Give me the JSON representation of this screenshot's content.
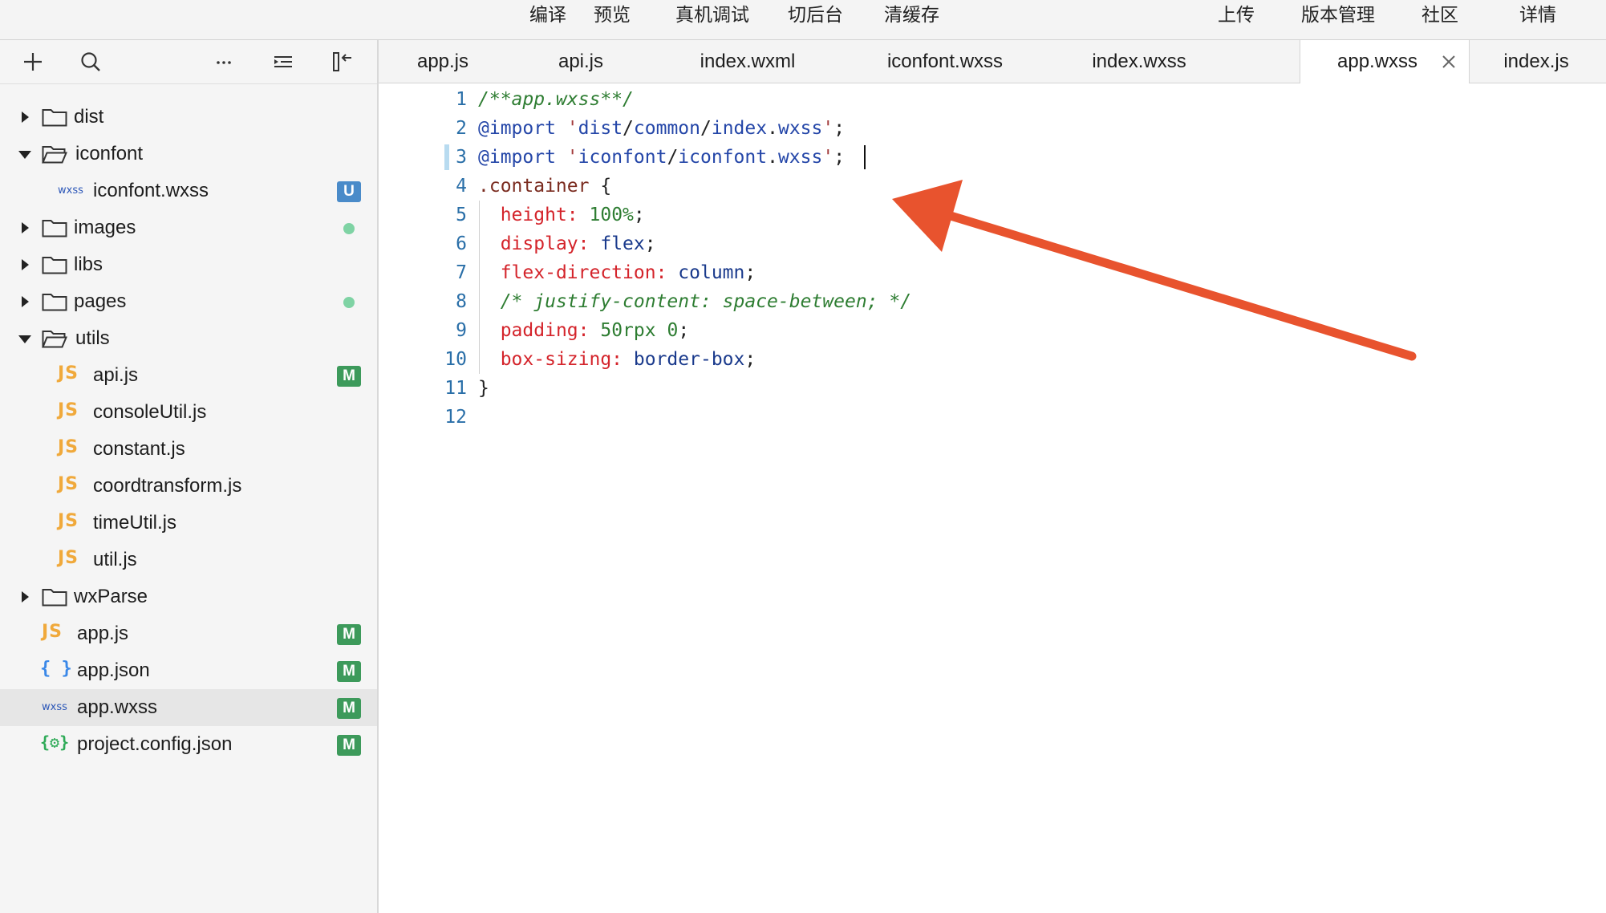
{
  "toolbar": {
    "compile": "编译",
    "preview": "预览",
    "remote_debug": "真机调试",
    "background": "切后台",
    "clear_cache": "清缓存",
    "upload": "上传",
    "version_mgmt": "版本管理",
    "community": "社区",
    "details": "详情"
  },
  "sidebar": {
    "tools": [
      "add-icon",
      "search-icon",
      "more-icon",
      "outline-icon",
      "collapse-sidebar-icon"
    ],
    "tree": [
      {
        "label": "dist",
        "type": "folder",
        "expanded": false
      },
      {
        "label": "iconfont",
        "type": "folder",
        "expanded": true
      },
      {
        "label": "iconfont.wxss",
        "type": "wxss",
        "badge": "U",
        "file_tag": "wxss"
      },
      {
        "label": "images",
        "type": "folder",
        "expanded": false,
        "dot": true
      },
      {
        "label": "libs",
        "type": "folder",
        "expanded": false
      },
      {
        "label": "pages",
        "type": "folder",
        "expanded": false,
        "dot": true
      },
      {
        "label": "utils",
        "type": "folder",
        "expanded": true
      },
      {
        "label": "api.js",
        "type": "js",
        "badge": "M",
        "file_tag": "JS"
      },
      {
        "label": "consoleUtil.js",
        "type": "js",
        "file_tag": "JS"
      },
      {
        "label": "constant.js",
        "type": "js",
        "file_tag": "JS"
      },
      {
        "label": "coordtransform.js",
        "type": "js",
        "file_tag": "JS"
      },
      {
        "label": "timeUtil.js",
        "type": "js",
        "file_tag": "JS"
      },
      {
        "label": "util.js",
        "type": "js",
        "file_tag": "JS"
      },
      {
        "label": "wxParse",
        "type": "folder",
        "expanded": false
      },
      {
        "label": "app.js",
        "type": "js",
        "badge": "M",
        "file_tag": "JS"
      },
      {
        "label": "app.json",
        "type": "json",
        "badge": "M",
        "file_tag": "{ }"
      },
      {
        "label": "app.wxss",
        "type": "wxss",
        "badge": "M",
        "file_tag": "wxss",
        "selected": true
      },
      {
        "label": "project.config.json",
        "type": "config",
        "badge": "M",
        "file_tag": "{⚙}"
      }
    ]
  },
  "tabs": [
    {
      "label": "app.js"
    },
    {
      "label": "api.js"
    },
    {
      "label": "index.wxml"
    },
    {
      "label": "iconfont.wxss"
    },
    {
      "label": "index.wxss"
    },
    {
      "label": "app.wxss",
      "active": true
    },
    {
      "label": "index.js"
    }
  ],
  "editor": {
    "line_numbers": [
      "1",
      "2",
      "3",
      "4",
      "5",
      "6",
      "7",
      "8",
      "9",
      "10",
      "11",
      "12"
    ],
    "lines": [
      "/**app.wxss**/",
      "@import 'dist/common/index.wxss';",
      "@import 'iconfont/iconfont.wxss';",
      ".container {",
      "  height: 100%;",
      "  display: flex;",
      "  flex-direction: column;",
      "  /* justify-content: space-between; */",
      "  padding: 50rpx 0;",
      "  box-sizing: border-box;",
      "}",
      ""
    ]
  },
  "colors": {
    "annotation_arrow": "#e8532e",
    "badge_modified": "#3d9a5b",
    "badge_untracked": "#4a8bc9",
    "dot_changed": "#7fd3a4"
  }
}
